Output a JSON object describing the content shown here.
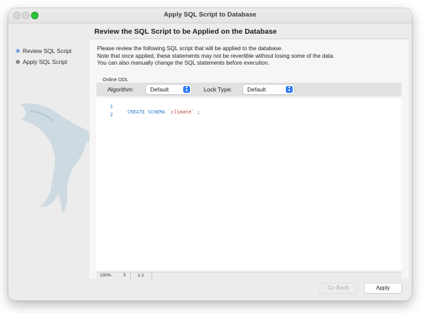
{
  "window": {
    "title": "Apply SQL Script to Database"
  },
  "sidebar": {
    "steps": [
      {
        "label": "Review SQL Script",
        "active": true
      },
      {
        "label": "Apply SQL Script",
        "active": false
      }
    ]
  },
  "main": {
    "heading": "Review the SQL Script to be Applied on the Database",
    "description": [
      "Please review the following SQL script that will be applied to the database.",
      "Note that once applied, these statements may not be revertible without losing some of the data.",
      "You can also manually change the SQL statements before execution."
    ],
    "online_ddl": {
      "label": "Online DDL",
      "algorithm": {
        "label": "Algorithm:",
        "value": "Default"
      },
      "lock_type": {
        "label": "Lock Type:",
        "value": "Default"
      }
    },
    "editor": {
      "lines": [
        {
          "number": "1",
          "keyword": "CREATE SCHEMA",
          "string": "`climate`",
          "punct": " ;"
        },
        {
          "number": "2",
          "keyword": "",
          "string": "",
          "punct": ""
        }
      ]
    },
    "status": {
      "zoom": "100%",
      "position": "1:1"
    }
  },
  "buttons": {
    "back": "Go Back",
    "apply": "Apply"
  },
  "colors": {
    "accent": "#2f7cf6",
    "keyword": "#2b7dcf",
    "string": "#c04141",
    "maximize": "#2dc13c"
  }
}
